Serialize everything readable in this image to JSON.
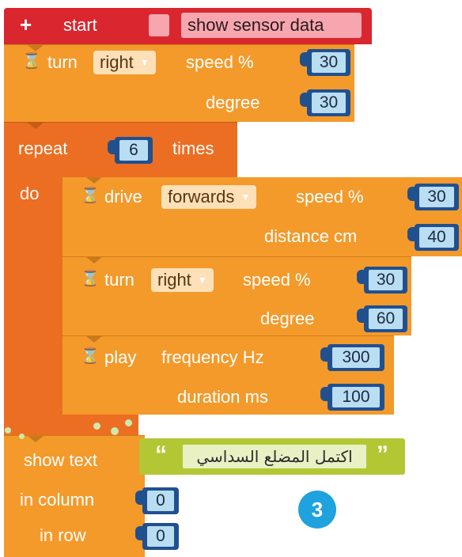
{
  "start": {
    "plus": "+",
    "label": "start",
    "show_sensor": "show sensor data"
  },
  "turn1": {
    "hourglass": "⌛",
    "label": "turn",
    "dir": "right",
    "speed_label": "speed %",
    "speed": "30",
    "deg_label": "degree",
    "deg": "30"
  },
  "repeat": {
    "label": "repeat",
    "count": "6",
    "times": "times",
    "do": "do"
  },
  "drive": {
    "hourglass": "⌛",
    "label": "drive",
    "dir": "forwards",
    "speed_label": "speed %",
    "speed": "30",
    "dist_label": "distance cm",
    "dist": "40"
  },
  "turn2": {
    "hourglass": "⌛",
    "label": "turn",
    "dir": "right",
    "speed_label": "speed %",
    "speed": "30",
    "deg_label": "degree",
    "deg": "60"
  },
  "play": {
    "hourglass": "⌛",
    "label": "play",
    "freq_label": "frequency Hz",
    "freq": "300",
    "dur_label": "duration ms",
    "dur": "100"
  },
  "show": {
    "label": "show text",
    "text": "اكتمل المضلع السداسي",
    "quote_open": "“",
    "quote_close": "”",
    "col_label": "in column",
    "col": "0",
    "row_label": "in row",
    "row": "0"
  },
  "badge": "3",
  "colors": {
    "start": "#d9262f",
    "orange": "#f39a2b",
    "loop": "#ec6e22",
    "text": "#b3c735",
    "socket": "#21508f",
    "badge": "#1fa2dd"
  },
  "icons": [
    "plus-icon",
    "hourglass-icon",
    "dropdown-arrow-icon",
    "quote-icon"
  ]
}
